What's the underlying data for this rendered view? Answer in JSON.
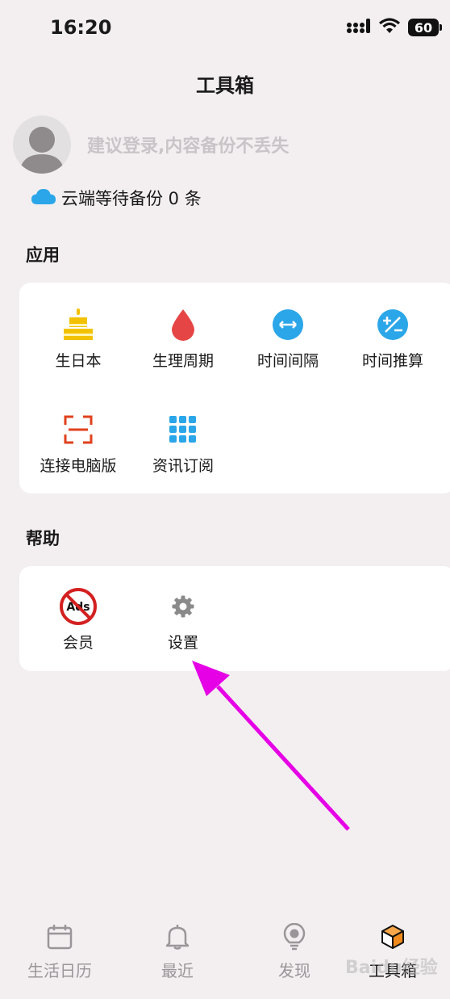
{
  "status": {
    "time": "16:20",
    "battery": "60"
  },
  "header": {
    "title": "工具箱"
  },
  "profile": {
    "login_hint": "建议登录,内容备份不丢失"
  },
  "backup": {
    "text": "云端等待备份 0 条"
  },
  "apps": {
    "title": "应用",
    "items": [
      {
        "label": "生日本",
        "icon": "cake-icon"
      },
      {
        "label": "生理周期",
        "icon": "drop-icon"
      },
      {
        "label": "时间间隔",
        "icon": "interval-icon"
      },
      {
        "label": "时间推算",
        "icon": "plus-minus-icon"
      },
      {
        "label": "连接电脑版",
        "icon": "scan-icon"
      },
      {
        "label": "资讯订阅",
        "icon": "grid-icon"
      }
    ]
  },
  "help": {
    "title": "帮助",
    "items": [
      {
        "label": "会员",
        "icon": "no-ads-icon",
        "badge": "Ads"
      },
      {
        "label": "设置",
        "icon": "gear-icon"
      }
    ]
  },
  "tabbar": {
    "items": [
      {
        "label": "生活日历",
        "icon": "calendar-icon"
      },
      {
        "label": "最近",
        "icon": "bell-icon"
      },
      {
        "label": "发现",
        "icon": "bulb-icon"
      },
      {
        "label": "工具箱",
        "icon": "box-icon",
        "active": true
      }
    ]
  },
  "watermark": "Baidu经验",
  "colors": {
    "accent_blue": "#2ba6e8",
    "red": "#e64545",
    "yellow": "#f2c200",
    "arrow": "#e600e6"
  }
}
